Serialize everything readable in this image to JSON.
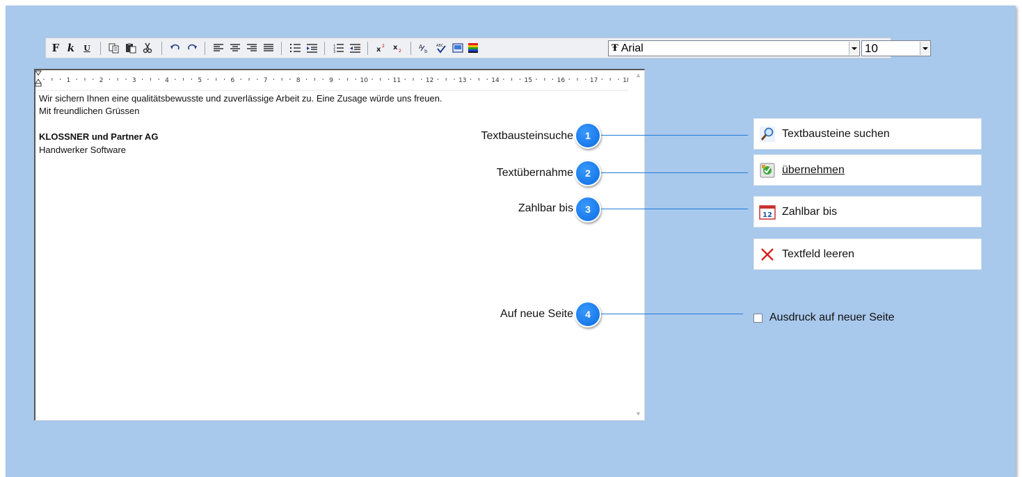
{
  "toolbar": {
    "bold_label": "F",
    "italic_label": "k",
    "underline_label": "U",
    "font_name": "Arial",
    "font_size": "10",
    "font_icon_glyph": "Ŧ"
  },
  "ruler": {
    "numbers": [
      "1",
      "2",
      "3",
      "4",
      "5",
      "6",
      "7",
      "8",
      "9",
      "10",
      "11",
      "12",
      "13",
      "14",
      "15",
      "16",
      "17",
      "18"
    ]
  },
  "editor": {
    "line1": "Wir sichern Ihnen eine qualitätsbewusste und zuverlässige Arbeit zu. Eine Zusage würde uns freuen.",
    "line2": "Mit freundlichen Grüssen",
    "line3": "KLOSSNER und Partner AG",
    "line4": "Handwerker Software"
  },
  "callouts": [
    {
      "label": "Textbausteinsuche",
      "number": "1"
    },
    {
      "label": "Textübernahme",
      "number": "2"
    },
    {
      "label": "Zahlbar bis",
      "number": "3"
    },
    {
      "label": "Auf neue Seite",
      "number": "4"
    }
  ],
  "buttons": {
    "search": "Textbausteine suchen",
    "accept": "übernehmen",
    "payable": "Zahlbar bis",
    "payable_icon_text": "12",
    "clear": "Textfeld leeren"
  },
  "checkbox": {
    "label": "Ausdruck auf neuer Seite",
    "checked": false
  },
  "colors": {
    "background": "#a8c8ec",
    "badge": "#1478e6",
    "connector": "#1f7ad8",
    "clear_icon": "#d42020",
    "calendar_icon": "#c83030"
  }
}
